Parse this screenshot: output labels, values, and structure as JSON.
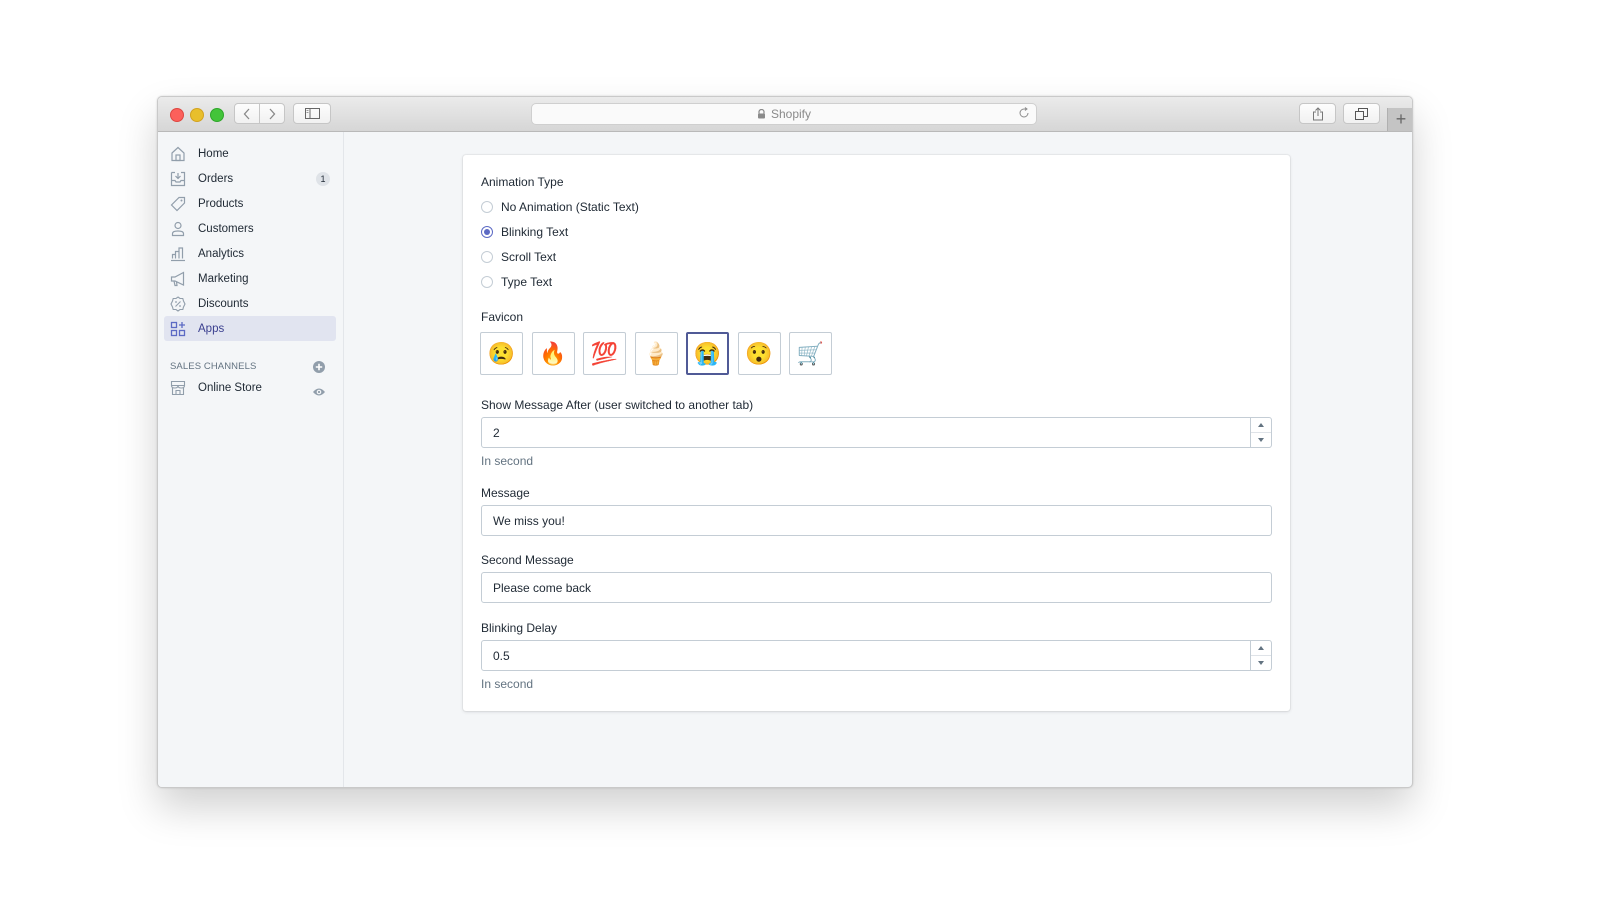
{
  "browser": {
    "address": "Shopify",
    "address_icon": "lock-icon",
    "buttons": [
      "back",
      "forward",
      "sidebar-toggle",
      "reload",
      "share",
      "show-tabs",
      "new-tab"
    ],
    "new_tab_label": "+"
  },
  "sidebar": {
    "items": [
      {
        "label": "Home",
        "icon": "home-icon"
      },
      {
        "label": "Orders",
        "icon": "orders-icon",
        "badge": "1"
      },
      {
        "label": "Products",
        "icon": "tag-icon"
      },
      {
        "label": "Customers",
        "icon": "person-icon"
      },
      {
        "label": "Analytics",
        "icon": "bar-chart-icon"
      },
      {
        "label": "Marketing",
        "icon": "megaphone-icon"
      },
      {
        "label": "Discounts",
        "icon": "discount-icon"
      },
      {
        "label": "Apps",
        "icon": "apps-icon",
        "active": true
      }
    ],
    "sales_channels": {
      "header": "SALES CHANNELS",
      "items": [
        {
          "label": "Online Store",
          "icon": "store-icon"
        }
      ]
    }
  },
  "form": {
    "animation_type": {
      "label": "Animation Type",
      "options": [
        "No Animation (Static Text)",
        "Blinking Text",
        "Scroll Text",
        "Type Text"
      ],
      "selected": "Blinking Text"
    },
    "favicon": {
      "label": "Favicon",
      "options": [
        {
          "name": "crying-face",
          "glyph": "😢"
        },
        {
          "name": "fire",
          "glyph": "🔥"
        },
        {
          "name": "hundred-points",
          "glyph": "💯"
        },
        {
          "name": "soft-ice-cream",
          "glyph": "🍦"
        },
        {
          "name": "loudly-crying-face",
          "glyph": "😭"
        },
        {
          "name": "hushed-face",
          "glyph": "😯"
        },
        {
          "name": "shopping-cart",
          "glyph": "🛒"
        }
      ],
      "selected": "loudly-crying-face"
    },
    "show_after": {
      "label": "Show Message After (user switched to another tab)",
      "value": "2",
      "help": "In second"
    },
    "message": {
      "label": "Message",
      "value": "We miss you!"
    },
    "second_message": {
      "label": "Second Message",
      "value": "Please come back"
    },
    "blinking_delay": {
      "label": "Blinking Delay",
      "value": "0.5",
      "help": "In second"
    }
  },
  "colors": {
    "accent": "#5c6ac4",
    "sidebar_active_bg": "#e1e4f0",
    "page_bg": "#f4f6f8"
  }
}
